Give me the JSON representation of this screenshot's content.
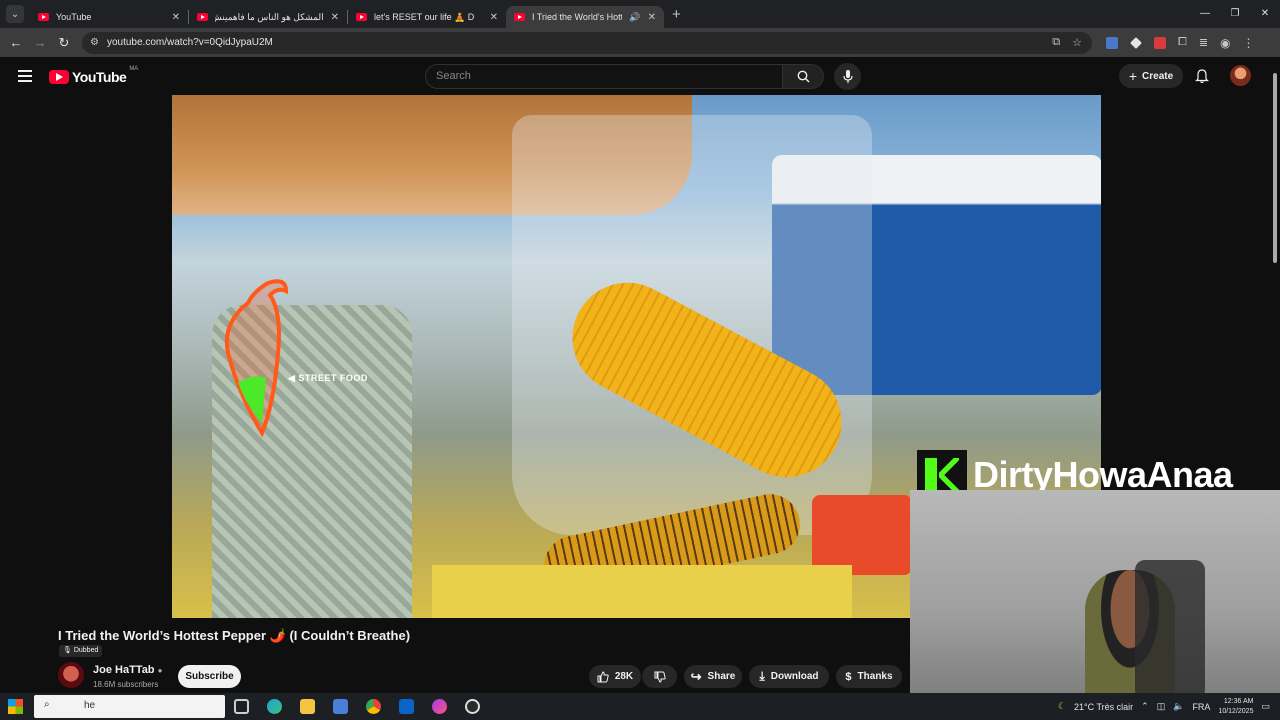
{
  "browser": {
    "tabs": [
      {
        "title": "YouTube",
        "active": false
      },
      {
        "title": "المشكل هو الناس ما فاهمينش ...",
        "active": false
      },
      {
        "title": "let's RESET our life 🧘 D",
        "active": false
      },
      {
        "title": "I Tried the World's Hottest P",
        "active": true
      }
    ],
    "url": "youtube.com/watch?v=0QidJypaU2M"
  },
  "youtube": {
    "logo_text": "YouTube",
    "country_code": "MA",
    "search_placeholder": "Search",
    "create_label": "Create"
  },
  "video": {
    "overlay_label": "◀ STREET  FOOD",
    "title": "I Tried the World’s Hottest Pepper 🌶️ (I Couldn’t Breathe)",
    "dubbed_badge": "Dubbed",
    "channel_name": "Joe HaTTab",
    "channel_subscribers": "18.6M subscribers",
    "subscribe_label": "Subscribe",
    "like_count": "28K",
    "share_label": "Share",
    "download_label": "Download",
    "thanks_label": "Thanks"
  },
  "stream_overlay": {
    "streamer_name": "DirtyHowaAnaa"
  },
  "taskbar": {
    "search_text": "he",
    "weather": "21°C  Très clair",
    "language": "FRA",
    "time": "12:36 AM",
    "date": "10/12/2025"
  },
  "colors": {
    "youtube_red": "#ff0033",
    "kick_green": "#53fc18"
  }
}
